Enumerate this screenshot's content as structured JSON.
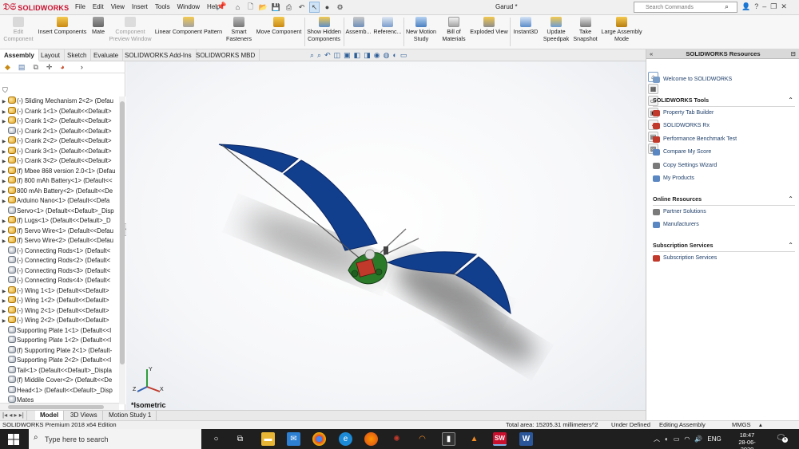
{
  "app": {
    "logo_text": "SOLIDWORKS",
    "document_title": "Garud *",
    "menu": [
      "File",
      "Edit",
      "View",
      "Insert",
      "Tools",
      "Window",
      "Help"
    ],
    "search_placeholder": "Search Commands",
    "quick_toolbar_icons": [
      "home-icon",
      "new-document-icon",
      "open-folder-icon",
      "save-icon",
      "print-icon",
      "undo-icon",
      "select-arrow-icon",
      "traffic-light-icon",
      "gear-icon"
    ],
    "title_icons": [
      "user-icon",
      "help-icon",
      "minimize-icon",
      "restore-icon",
      "close-icon"
    ]
  },
  "command_manager": {
    "buttons": [
      {
        "label": "Edit\nComponent",
        "disabled": true
      },
      {
        "label": "Insert Components",
        "disabled": false
      },
      {
        "label": "Mate",
        "disabled": false
      },
      {
        "label": "Component\nPreview Window",
        "disabled": true
      },
      {
        "label": "Linear Component Pattern",
        "disabled": false
      },
      {
        "label": "Smart\nFasteners",
        "disabled": false
      },
      {
        "label": "Move Component",
        "disabled": false
      },
      {
        "label": "Show Hidden\nComponents",
        "disabled": false
      },
      {
        "label": "Assemb...",
        "disabled": false
      },
      {
        "label": "Referenc...",
        "disabled": false
      },
      {
        "label": "New Motion\nStudy",
        "disabled": false
      },
      {
        "label": "Bill of\nMaterials",
        "disabled": false
      },
      {
        "label": "Exploded View",
        "disabled": false
      },
      {
        "label": "Instant3D",
        "disabled": false
      },
      {
        "label": "Update\nSpeedpak",
        "disabled": false
      },
      {
        "label": "Take\nSnapshot",
        "disabled": false
      },
      {
        "label": "Large Assembly\nMode",
        "disabled": false
      }
    ]
  },
  "tabs": [
    "Assembly",
    "Layout",
    "Sketch",
    "Evaluate",
    "SOLIDWORKS Add-Ins",
    "SOLIDWORKS MBD"
  ],
  "active_tab": "Assembly",
  "feature_tree": {
    "panel_icons": [
      "feature-manager-icon",
      "property-manager-icon",
      "configuration-manager-icon",
      "dimxpert-icon",
      "display-manager-icon"
    ],
    "items": [
      {
        "label": "(-) Sliding Mechanism 2<2> (Defau",
        "type": "sub",
        "expand": true
      },
      {
        "label": "(-) Crank 1<1> (Default<<Default>",
        "type": "sub",
        "expand": true
      },
      {
        "label": "(-) Crank 1<2> (Default<<Default>",
        "type": "sub",
        "expand": true
      },
      {
        "label": "(-) Crank 2<1> (Default<<Default>",
        "type": "part",
        "expand": false
      },
      {
        "label": "(-) Crank 2<2> (Default<<Default>",
        "type": "sub",
        "expand": true
      },
      {
        "label": "(-) Crank 3<1> (Default<<Default>",
        "type": "sub",
        "expand": true
      },
      {
        "label": "(-) Crank 3<2> (Default<<Default>",
        "type": "sub",
        "expand": true
      },
      {
        "label": "(f) Mbee 868 version 2.0<1> (Defau",
        "type": "sub",
        "expand": true
      },
      {
        "label": "(f) 800 mAh Battery<1> (Default<<",
        "type": "sub",
        "expand": true
      },
      {
        "label": "800 mAh Battery<2> (Default<<De",
        "type": "sub",
        "expand": true
      },
      {
        "label": "Arduino Nano<1> (Default<<Defa",
        "type": "sub",
        "expand": true
      },
      {
        "label": "Servo<1> (Default<<Default>_Disp",
        "type": "part",
        "expand": false
      },
      {
        "label": "(f) Lugs<1> (Default<<Default>_D",
        "type": "sub",
        "expand": true
      },
      {
        "label": "(f) Servo Wire<1> (Default<<Defau",
        "type": "sub",
        "expand": true
      },
      {
        "label": "(f) Servo Wire<2> (Default<<Defau",
        "type": "sub",
        "expand": true
      },
      {
        "label": "(-) Connecting Rods<1> (Default<",
        "type": "part",
        "expand": false
      },
      {
        "label": "(-) Connecting Rods<2> (Default<",
        "type": "part",
        "expand": false
      },
      {
        "label": "(-) Connecting Rods<3> (Default<",
        "type": "part",
        "expand": false
      },
      {
        "label": "(-) Connecting Rods<4> (Default<",
        "type": "part",
        "expand": false
      },
      {
        "label": "(-) Wing 1<1> (Default<<Default>",
        "type": "sub",
        "expand": true
      },
      {
        "label": "(-) Wing 1<2> (Default<<Default>",
        "type": "sub",
        "expand": true
      },
      {
        "label": "(-) Wing 2<1> (Default<<Default>",
        "type": "sub",
        "expand": true
      },
      {
        "label": "(-) Wing 2<2> (Default<<Default>",
        "type": "sub",
        "expand": true
      },
      {
        "label": "Supporting Plate 1<1> (Default<<I",
        "type": "part",
        "expand": false
      },
      {
        "label": "Supporting Plate 1<2> (Default<<I",
        "type": "part",
        "expand": false
      },
      {
        "label": "(f) Supporting Plate 2<1> (Default-",
        "type": "part",
        "expand": false
      },
      {
        "label": "Supporting Plate 2<2> (Default<<I",
        "type": "part",
        "expand": false
      },
      {
        "label": "Tail<1> (Default<<Default>_Displa",
        "type": "part",
        "expand": false
      },
      {
        "label": "(f) Middile Cover<2> (Default<<De",
        "type": "part",
        "expand": false
      },
      {
        "label": "Head<1> (Default<<Default>_Disp",
        "type": "part",
        "expand": false
      },
      {
        "label": "Mates",
        "type": "part",
        "expand": false
      }
    ]
  },
  "viewport": {
    "view_label": "*Isometric",
    "hud_icons": [
      "zoom-to-fit-icon",
      "zoom-area-icon",
      "previous-view-icon",
      "section-view-icon",
      "dynamic-annotation-icon",
      "view-orientation-icon",
      "display-style-icon",
      "hide-show-icon",
      "edit-appearance-icon",
      "apply-scene-icon",
      "view-settings-icon"
    ],
    "triad": {
      "x": "X",
      "y": "Y",
      "z": "Z"
    }
  },
  "model_tabs": [
    "Model",
    "3D Views",
    "Motion Study 1"
  ],
  "active_model_tab": "Model",
  "task_pane": {
    "title": "SOLIDWORKS Resources",
    "welcome": "Welcome to SOLIDWORKS",
    "sections": [
      {
        "title": "SOLIDWORKS Tools",
        "links": [
          "Property Tab Builder",
          "SOLIDWORKS Rx",
          "Performance Benchmark Test",
          "Compare My Score",
          "Copy Settings Wizard",
          "My Products"
        ]
      },
      {
        "title": "Online Resources",
        "links": [
          "Partner Solutions",
          "Manufacturers"
        ]
      },
      {
        "title": "Subscription Services",
        "links": [
          "Subscription Services"
        ]
      }
    ],
    "side_icons": [
      "home-icon",
      "parts-library-icon",
      "file-explorer-icon",
      "view-palette-icon",
      "appearances-icon",
      "custom-properties-icon",
      "solidworks-forum-icon"
    ]
  },
  "status_bar": {
    "edition": "SOLIDWORKS Premium 2018 x64 Edition",
    "total_area": "Total area: 15205.31 millimeters^2",
    "state": "Under Defined",
    "mode": "Editing Assembly",
    "units": "MMGS"
  },
  "taskbar": {
    "search_placeholder": "Type here to search",
    "apps": [
      "cortana-icon",
      "task-view-icon",
      "file-explorer-icon",
      "mail-icon",
      "chrome-icon",
      "edge-icon",
      "firefox-icon",
      "network-app-icon",
      "app-icon",
      "matlab-icon",
      "vlc-icon",
      "solidworks-icon",
      "word-icon"
    ],
    "language": "ENG",
    "time": "18:47",
    "date": "28-06-2020",
    "notification_count": "5"
  },
  "colors": {
    "brand_red": "#c8102e",
    "wing_blue": "#123e8e",
    "taskbar": "#1f1f1f"
  }
}
